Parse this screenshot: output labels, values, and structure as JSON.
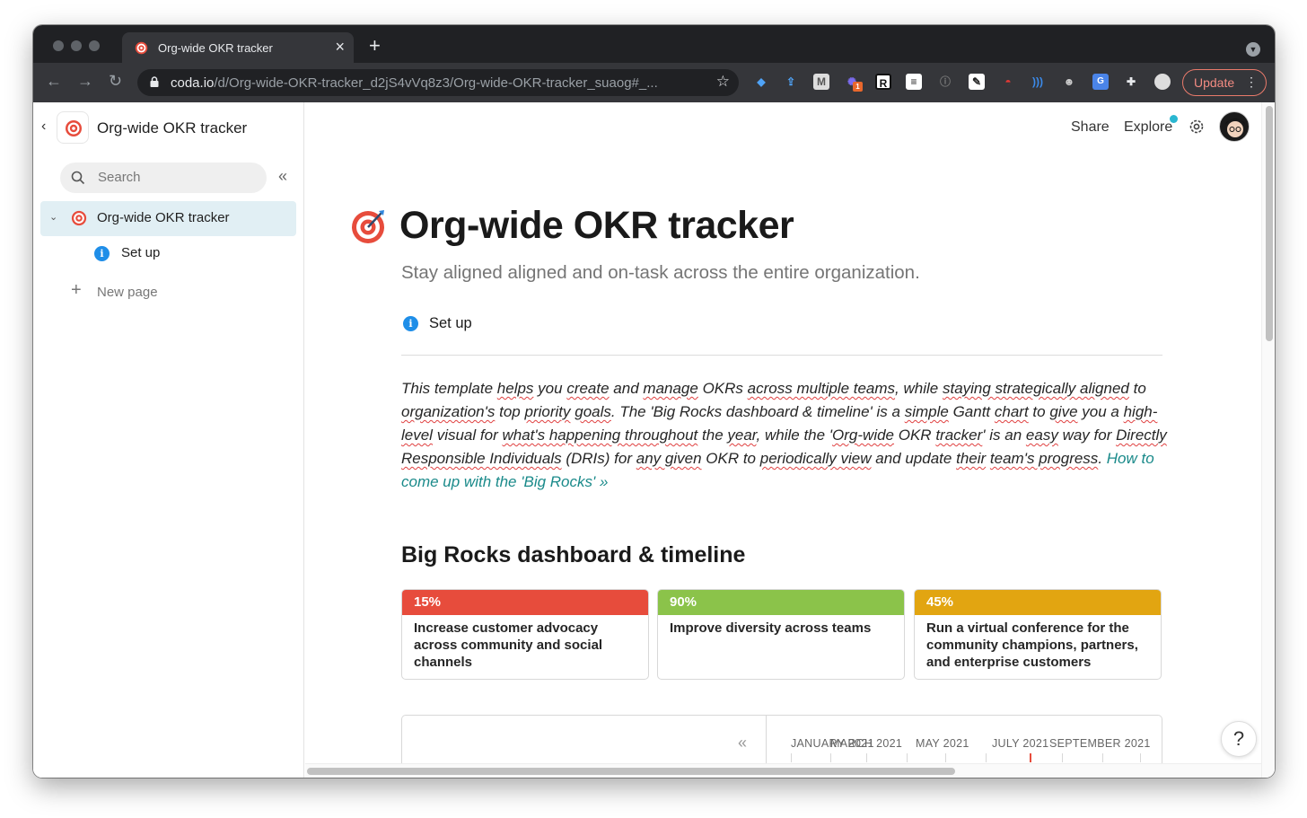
{
  "browser": {
    "tab_title": "Org-wide OKR tracker",
    "url_host": "coda.io",
    "url_path": "/d/Org-wide-OKR-tracker_d2jS4vVq8z3/Org-wide-OKR-tracker_suaog#_...",
    "update_label": "Update",
    "extension_badge": "1"
  },
  "sidebar": {
    "doc_title": "Org-wide OKR tracker",
    "search_placeholder": "Search",
    "pages": [
      {
        "label": "Org-wide OKR tracker"
      },
      {
        "label": "Set up"
      }
    ],
    "new_page_label": "New page"
  },
  "header": {
    "share_label": "Share",
    "explore_label": "Explore"
  },
  "page": {
    "title": "Org-wide OKR tracker",
    "subtitle": "Stay aligned aligned and on-task across the entire organization.",
    "setup_link": "Set up",
    "body": {
      "t1": "This template",
      "t2": "helps",
      "t3": "you",
      "t4": "create",
      "t5": "and",
      "t6": "manage",
      "t7": "OKRs",
      "t8": "across multiple teams",
      "t9": ", while",
      "t10": "staying strategically aligned",
      "t11": "to",
      "t12": "organization's",
      "t13": "top",
      "t14": "priority",
      "t15": "goals",
      "t16": ". The 'Big Rocks dashboard & timeline' is a",
      "t17": "simple",
      "t18": "Gantt",
      "t19": "chart",
      "t20": "to",
      "t21": "give",
      "t22": "you a",
      "t23": "high-level",
      "t24": "visual for",
      "t25": "what's happening throughout",
      "t26": "the",
      "t27": "year",
      "t28": ", while the '",
      "t29": "Org-wide",
      "t30": "OKR",
      "t31": "tracker",
      "t32": "' is an",
      "t33": "easy",
      "t34": "way for",
      "t35": "Directly Responsible Individuals",
      "t36": "(DRIs) for",
      "t37": "any given",
      "t38": "OKR to",
      "t39": "periodically view",
      "t40": "and update",
      "t41": "their",
      "t42": "team's progress",
      "t43": ".",
      "link": "How to come up with the 'Big Rocks' »"
    },
    "section_heading": "Big Rocks dashboard & timeline",
    "cards": [
      {
        "percent": "15%",
        "progress": 0.15,
        "color": "#e74c3c",
        "text": "Increase customer advocacy across community and social channels"
      },
      {
        "percent": "90%",
        "progress": 0.9,
        "color": "#8bc34a",
        "text": "Improve diversity across teams"
      },
      {
        "percent": "45%",
        "progress": 0.45,
        "color": "#e2a511",
        "text": "Run a virtual conference for the community champions, partners, and enterprise customers"
      }
    ],
    "timeline_months": [
      "JANUARY 2021",
      "MARCH 2021",
      "MAY 2021",
      "JULY 2021",
      "SEPTEMBER 2021"
    ],
    "help_label": "?"
  },
  "colors": {
    "accent_link": "#1a8a8a",
    "active_nav_bg": "#e1eff4",
    "info_blue": "#1f8ee8"
  }
}
